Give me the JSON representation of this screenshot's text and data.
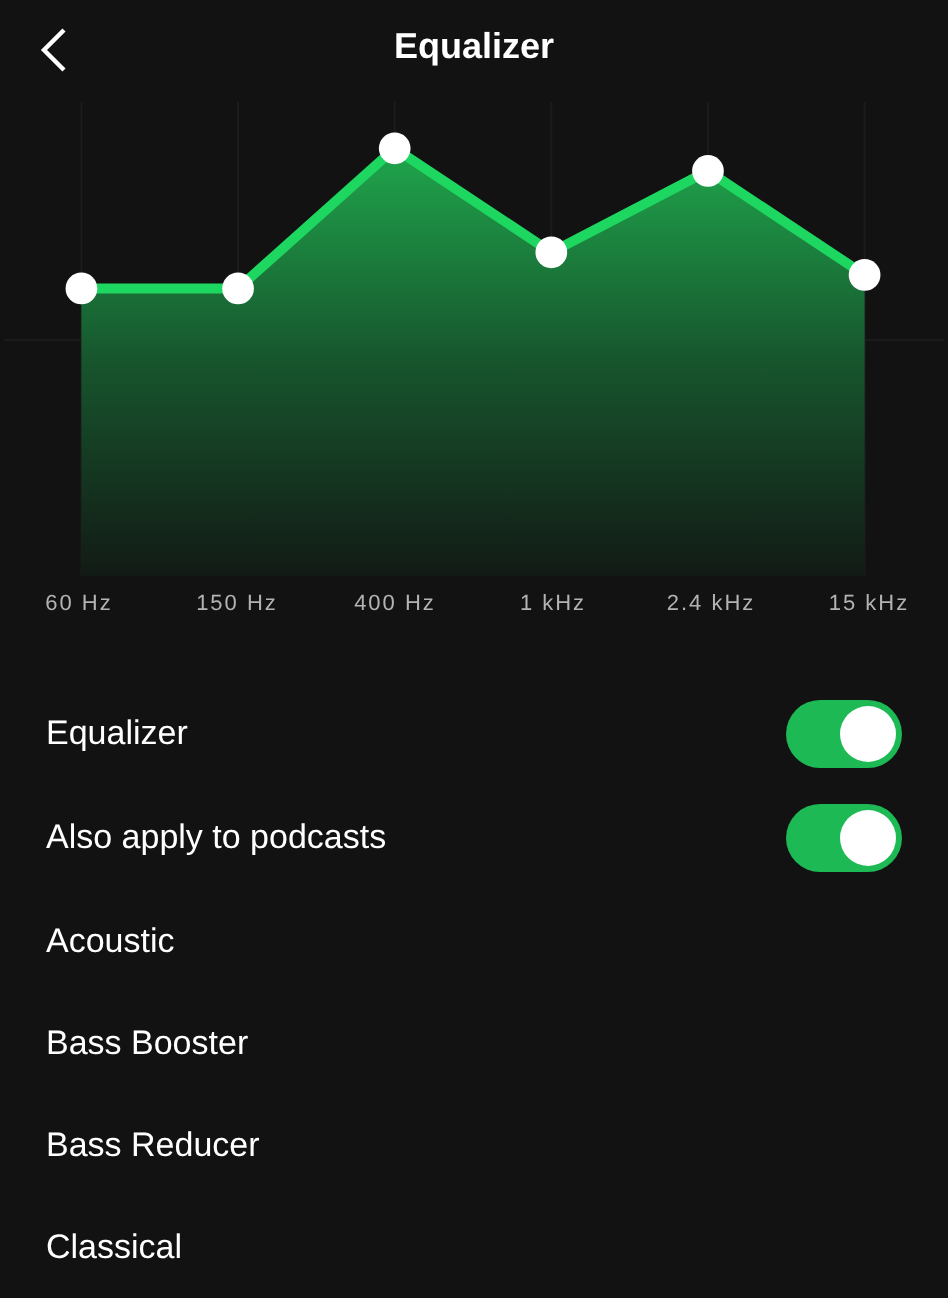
{
  "header": {
    "title": "Equalizer"
  },
  "bands": [
    {
      "label": "60 Hz"
    },
    {
      "label": "150 Hz"
    },
    {
      "label": "400 Hz"
    },
    {
      "label": "1 kHz"
    },
    {
      "label": "2.4 kHz"
    },
    {
      "label": "15 kHz"
    }
  ],
  "settings": [
    {
      "kind": "toggle",
      "label": "Equalizer",
      "on": true
    },
    {
      "kind": "toggle",
      "label": "Also apply to podcasts",
      "on": true
    },
    {
      "kind": "preset",
      "label": "Acoustic"
    },
    {
      "kind": "preset",
      "label": "Bass Booster"
    },
    {
      "kind": "preset",
      "label": "Bass Reducer"
    },
    {
      "kind": "preset",
      "label": "Classical"
    }
  ]
}
